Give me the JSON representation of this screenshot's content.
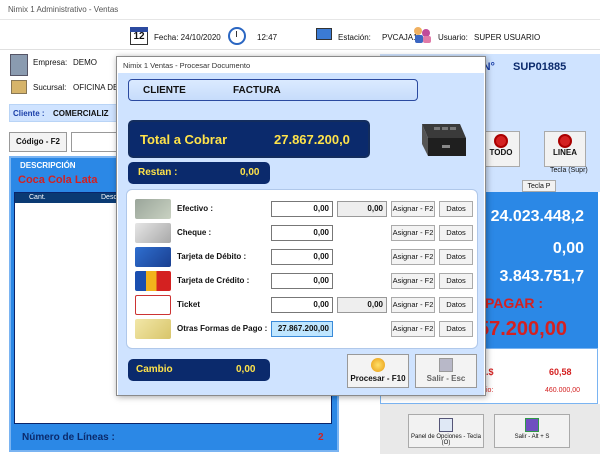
{
  "window": {
    "title": "Nimix 1 Administrativo - Ventas"
  },
  "header": {
    "calendar_day": "12",
    "fecha": "Fecha: 24/10/2020",
    "hora": "12:47",
    "estacion_label": "Estación:",
    "estacion_value": "PVCAJA1",
    "usuario_label": "Usuario:",
    "usuario_value": "SUPER USUARIO"
  },
  "left": {
    "empresa_label": "Empresa:",
    "empresa_value": "DEMO",
    "sucursal_label": "Sucursal:",
    "sucursal_value": "OFICINA DEM",
    "cliente_label": "Cliente :",
    "cliente_value": "COMERCIALIZ",
    "codigo_label": "Código - F2",
    "descripcion_label": "DESCRIPCIÓN",
    "item_desc": "Coca Cola Lata",
    "col_cant": "Cant.",
    "col_desc": "Desc",
    "lineas_label": "Número de Líneas :",
    "lineas_value": "2"
  },
  "right": {
    "ndoc_label": "A N°",
    "ndoc_value": "SUP01885",
    "todo_label": "TODO",
    "linea_label": "LINEA",
    "tecla_supr": "Tecla (Supr)",
    "tecla_p": "Tecla P",
    "val1": "24.023.448,2",
    "val2": "0,00",
    "val3": "3.843.751,7",
    "pagar_label": "PAGAR :",
    "pagar_value": "57.200,00",
    "small_label": ".$",
    "small_value": "60,58",
    "small_value2": "460.000,00",
    "small_label2": "io:",
    "panel_opciones": "Panel de Opciones - Tecla (O)",
    "salir_alt": "Salir - Alt + S"
  },
  "dialog": {
    "title": "Nimix 1 Ventas - Procesar Documento",
    "cliente": "CLIENTE",
    "doc_type": "FACTURA",
    "total_label": "Total a Cobrar",
    "total_value": "27.867.200,0",
    "restan_label": "Restan :",
    "restan_value": "0,00",
    "cambio_label": "Cambio",
    "cambio_value": "0,00",
    "procesar_label": "Procesar - F10",
    "salir_label": "Salir - Esc",
    "payments": [
      {
        "label": "Efectivo :",
        "value": "0,00",
        "value2": "0,00",
        "assign": "Asignar - F2",
        "datos": "Datos",
        "icon": "cash-icon"
      },
      {
        "label": "Cheque :",
        "value": "0,00",
        "value2": "",
        "assign": "Asignar - F2",
        "datos": "Datos",
        "icon": "check-icon"
      },
      {
        "label": "Tarjeta de Débito :",
        "value": "0,00",
        "value2": "",
        "assign": "Asignar - F2",
        "datos": "Datos",
        "icon": "debit-card-icon"
      },
      {
        "label": "Tarjeta de Crédito :",
        "value": "0,00",
        "value2": "",
        "assign": "Asignar - F2",
        "datos": "Datos",
        "icon": "credit-card-icon"
      },
      {
        "label": "Ticket",
        "value": "0,00",
        "value2": "0,00",
        "assign": "Asignar - F2",
        "datos": "Datos",
        "icon": "ticket-icon"
      },
      {
        "label": "Otras Formas de Pago :",
        "value": "27.867.200,00",
        "value2": "",
        "assign": "Asignar - F2",
        "datos": "Datos",
        "icon": "other-payment-icon"
      }
    ]
  },
  "colors": {
    "navy": "#0b2a6c",
    "yellow": "#ffe34a",
    "blue_panel": "#2b88e6",
    "light_blue": "#cfe3ff",
    "red": "#d42121"
  }
}
